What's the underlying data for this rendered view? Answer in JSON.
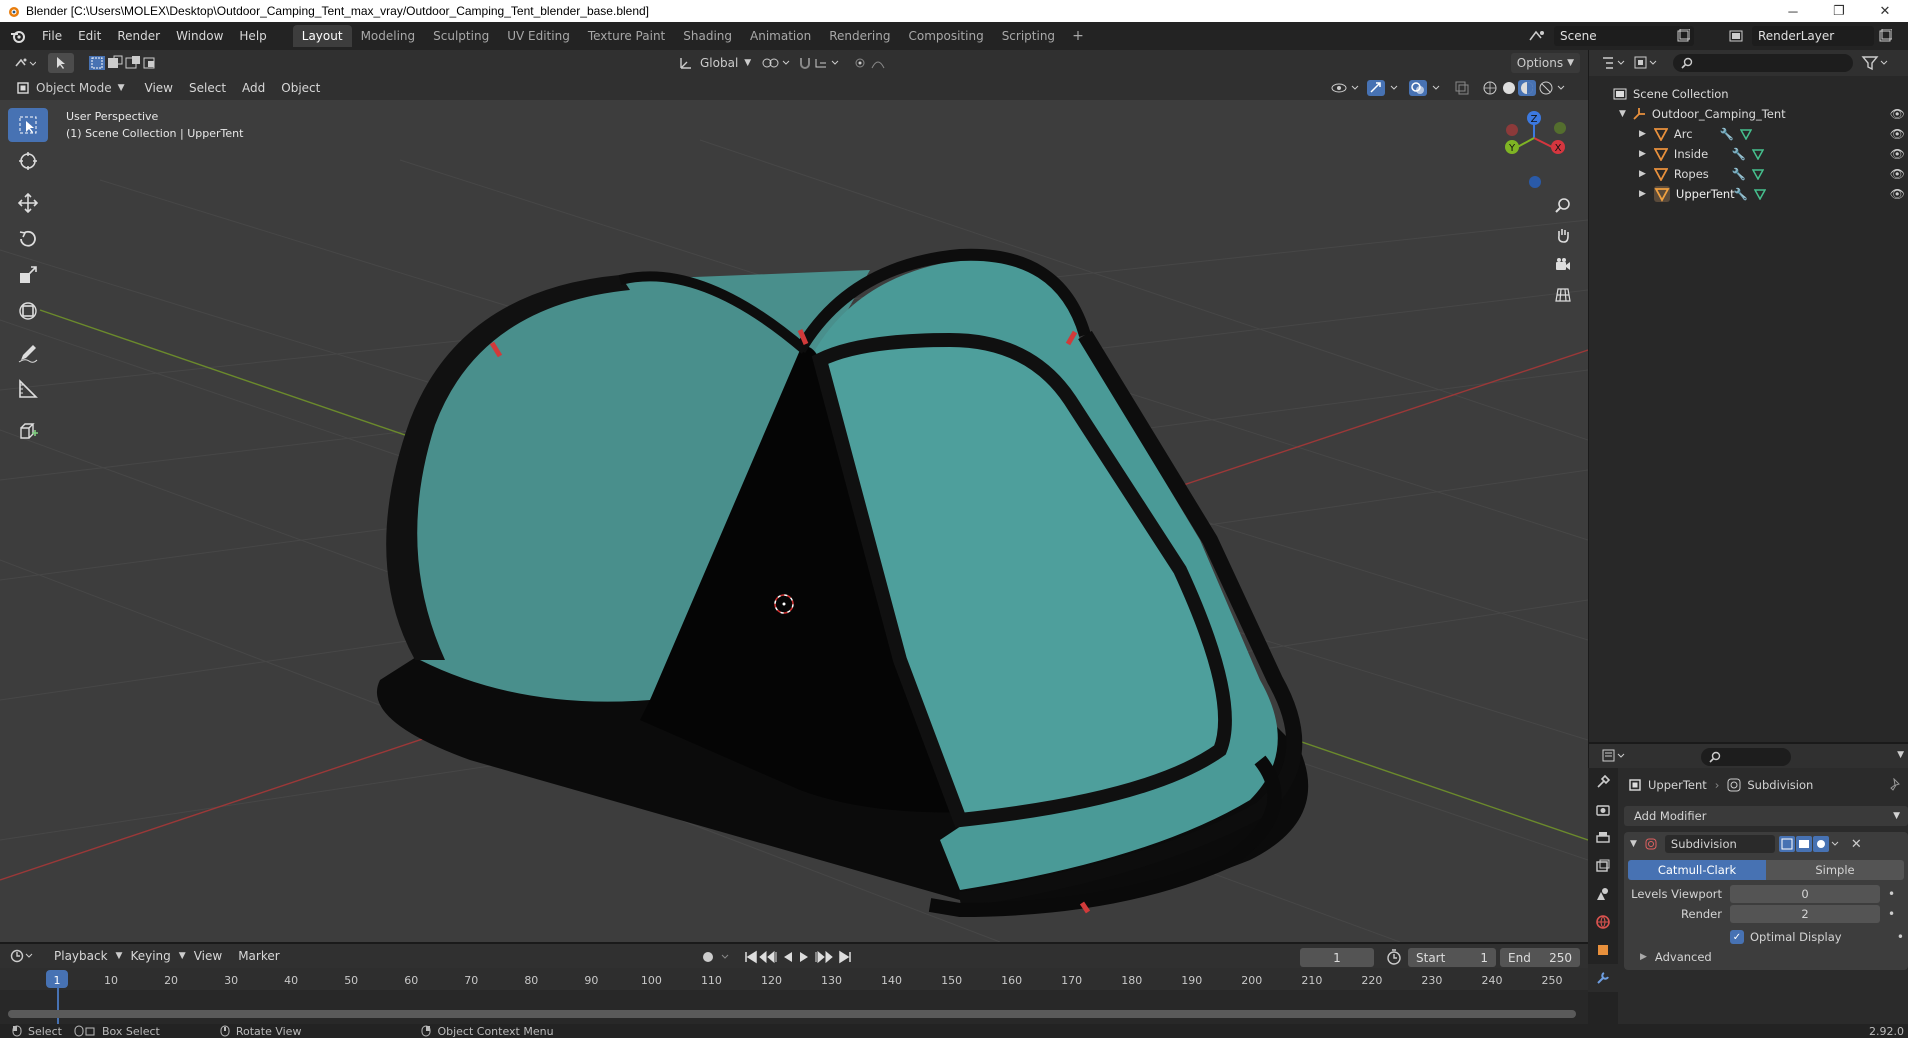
{
  "window": {
    "title": "Blender [C:\\Users\\MOLEX\\Desktop\\Outdoor_Camping_Tent_max_vray/Outdoor_Camping_Tent_blender_base.blend]",
    "minimize": "─",
    "maximize": "❐",
    "close": "✕"
  },
  "menu": {
    "items": [
      "File",
      "Edit",
      "Render",
      "Window",
      "Help"
    ],
    "workspaces": [
      "Layout",
      "Modeling",
      "Sculpting",
      "UV Editing",
      "Texture Paint",
      "Shading",
      "Animation",
      "Rendering",
      "Compositing",
      "Scripting"
    ],
    "active_workspace": "Layout",
    "add": "+",
    "scene": "Scene",
    "view_layer": "RenderLayer"
  },
  "tool_header": {
    "orientation": "Global",
    "options": "Options"
  },
  "viewport_header": {
    "mode": "Object Mode",
    "menus": [
      "View",
      "Select",
      "Add",
      "Object"
    ]
  },
  "viewport": {
    "perspective": "User Perspective",
    "collection": "(1) Scene Collection | UpperTent",
    "gizmo": {
      "x": "X",
      "y": "Y",
      "z": "Z"
    }
  },
  "outliner": {
    "root": "Scene Collection",
    "collection": "Outdoor_Camping_Tent",
    "objects": [
      "Arc",
      "Inside",
      "Ropes",
      "UpperTent"
    ]
  },
  "properties": {
    "object": "UpperTent",
    "modifier_breadcrumb": "Subdivision",
    "add_modifier": "Add Modifier",
    "modifier_name": "Subdivision",
    "methods": [
      "Catmull-Clark",
      "Simple"
    ],
    "active_method": "Catmull-Clark",
    "levels_viewport_label": "Levels Viewport",
    "levels_viewport": "0",
    "render_label": "Render",
    "render": "2",
    "optimal_display": "Optimal Display",
    "optimal_display_checked": true,
    "advanced": "Advanced"
  },
  "timeline": {
    "menus": [
      "Playback",
      "Keying",
      "View",
      "Marker"
    ],
    "current_frame": "1",
    "start_label": "Start",
    "start": "1",
    "end_label": "End",
    "end": "250",
    "ruler": [
      "1",
      "10",
      "20",
      "30",
      "40",
      "50",
      "60",
      "70",
      "80",
      "90",
      "100",
      "110",
      "120",
      "130",
      "140",
      "150",
      "160",
      "170",
      "180",
      "190",
      "200",
      "210",
      "220",
      "230",
      "240",
      "250"
    ]
  },
  "statusbar": {
    "select": "Select",
    "box_select": "Box Select",
    "rotate_view": "Rotate View",
    "context_menu": "Object Context Menu",
    "version": "2.92.0"
  },
  "colors": {
    "accent": "#4772b3",
    "tent_teal": "#4a9a97",
    "axis_x": "#d5363f",
    "axis_y": "#7fb424",
    "axis_z": "#3c79e0"
  }
}
